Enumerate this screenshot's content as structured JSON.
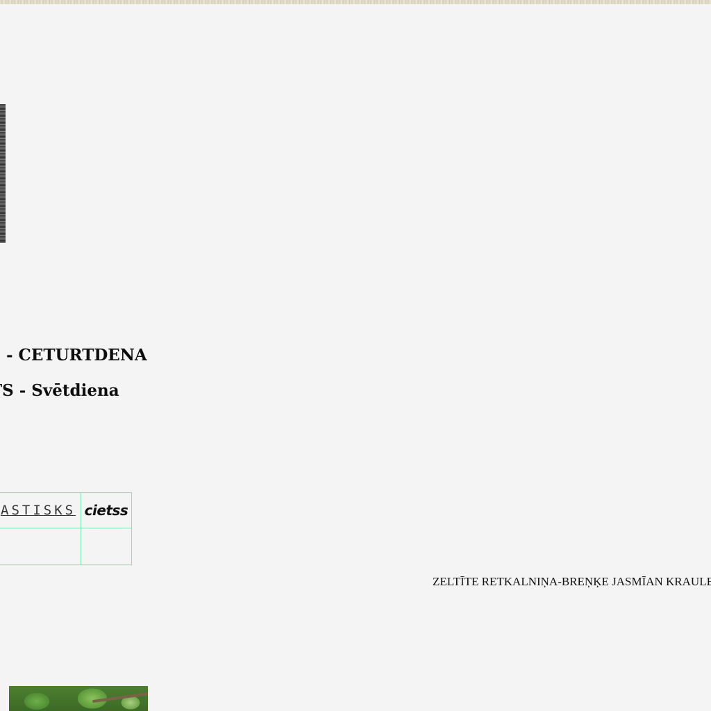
{
  "schedule": {
    "line1": "s - CETURTDENA",
    "line2": "TS - Svētdiena"
  },
  "table": {
    "link_label": "ASTISKS",
    "closed_label": "cietss"
  },
  "names": "ZELTĪTE RETKALNIŅA-BREŅĶE JASMĪAN KRAULE-LE",
  "images": {
    "top_strip": "decorative-texture",
    "side_photo": "dark-photo",
    "bottom_photo": "green-leaves-photo"
  }
}
